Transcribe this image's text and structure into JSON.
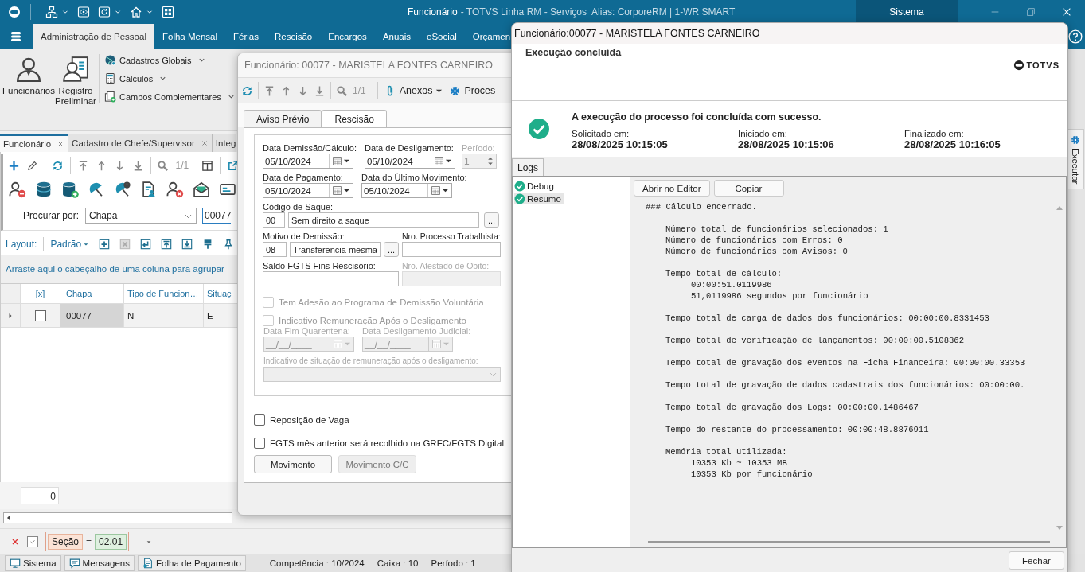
{
  "app": {
    "title_main": "Funcionário",
    "title_rest": "- TOTVS Linha RM - Serviços  Alias: CorporeRM | 1-WR SMART",
    "system_tab": "Sistema",
    "menu": [
      {
        "label": "Administração de Pessoal",
        "selected": true
      },
      {
        "label": "Folha Mensal",
        "selected": false
      },
      {
        "label": "Férias",
        "selected": false
      },
      {
        "label": "Rescisão",
        "selected": false
      },
      {
        "label": "Encargos",
        "selected": false
      },
      {
        "label": "Anuais",
        "selected": false
      },
      {
        "label": "eSocial",
        "selected": false
      },
      {
        "label": "Orçamen",
        "selected": false
      }
    ],
    "ribbon_big": [
      {
        "label": "Funcionários",
        "kind": "person"
      },
      {
        "label": "Registro Preliminar",
        "kind": "record"
      }
    ],
    "ribbon_small": [
      {
        "label": "Cadastros Globais",
        "kind": "globe"
      },
      {
        "label": "Cálculos",
        "kind": "calculator"
      },
      {
        "label": "Campos Complementares",
        "kind": "fields"
      }
    ],
    "doc_tabs": [
      {
        "label": "Funcionário",
        "selected": true,
        "closable": true
      },
      {
        "label": "Cadastro de Chefe/Supervisor",
        "selected": false,
        "closable": true
      },
      {
        "label": "Integ",
        "selected": false,
        "closable": false
      }
    ],
    "record_counter": "1/1",
    "search": {
      "label": "Procurar por:",
      "field": "Chapa",
      "value": "00077"
    },
    "layout": {
      "label": "Layout:",
      "value": "Padrão"
    },
    "group_hint": "Arraste aqui o cabeçalho de uma coluna para agrupar",
    "columns": [
      "[x]",
      "Chapa",
      "Tipo de Funcion…",
      "Situaç"
    ],
    "rows": [
      {
        "checked": false,
        "selected": true,
        "cells": [
          "",
          "00077",
          "N",
          "E"
        ]
      }
    ],
    "count": "0",
    "filter": {
      "enabled": true,
      "field": "Seção",
      "op": "=",
      "value": "02.01"
    },
    "status_items": [
      {
        "label": "Sistema",
        "kind": "monitor"
      },
      {
        "label": "Mensagens",
        "kind": "chat"
      },
      {
        "label": "Folha de Pagamento",
        "kind": "document"
      }
    ],
    "status_info": [
      "Competência : 10/2024",
      "Caixa : 10",
      "Período : 1"
    ],
    "side_tab": "Executar"
  },
  "rescisao": {
    "title": "Funcionário: 00077 - MARISTELA FONTES CARNEIRO",
    "counter": "1/1",
    "attach": "Anexos",
    "process": "Proces",
    "tabs": [
      {
        "label": "Aviso Prévio",
        "selected": false
      },
      {
        "label": "Rescisão",
        "selected": true
      }
    ],
    "dates": [
      {
        "label": "Data Demissão/Cálculo:",
        "value": "05/10/2024"
      },
      {
        "label": "Data de Desligamento:",
        "value": "05/10/2024"
      },
      {
        "label": "Data de Pagamento:",
        "value": "05/10/2024"
      },
      {
        "label": "Data do Último Movimento:",
        "value": "05/10/2024"
      }
    ],
    "period": {
      "label": "Período:",
      "value": "1",
      "disabled": true
    },
    "saque": {
      "label": "Código de Saque:",
      "code": "00",
      "description": "Sem direito a saque",
      "browse": "..."
    },
    "motivo": {
      "label": "Motivo de Demissão:",
      "code": "08",
      "description": "Transferencia mesma",
      "browse": "..."
    },
    "processo": {
      "label": "Nro. Processo Trabalhista:",
      "disabled": false
    },
    "saldo": {
      "label": "Saldo FGTS Fins Rescisório:",
      "disabled": false
    },
    "atestado": {
      "label": "Nro. Atestado de Obito:",
      "disabled": true
    },
    "pdv": {
      "label": "Tem Adesão ao Programa de Demissão Voluntária",
      "checked": false,
      "disabled": true
    },
    "remuneracao": {
      "label": "Indicativo Remuneração Após o Desligamento",
      "checked": false,
      "disabled": true,
      "quarentena_label": "Data Fim Quarentena:",
      "quarentena_value": "__/__/____",
      "judicial_label": "Data Desligamento Judicial:",
      "judicial_value": "__/__/____",
      "situacao_label": "Indicativo de situação de remuneração após o desligamento:"
    },
    "checks": [
      {
        "label": "Reposição de Vaga",
        "checked": false
      },
      {
        "label": "FGTS mês anterior será recolhido na GRFC/FGTS Digital",
        "checked": false
      }
    ],
    "buttons": [
      {
        "label": "Movimento",
        "disabled": false
      },
      {
        "label": "Movimento C/C",
        "disabled": true
      }
    ]
  },
  "execucao": {
    "title": "Funcionário:00077 - MARISTELA FONTES CARNEIRO",
    "heading": "Execução concluída",
    "logo": "TOTVS",
    "message": "A execução do processo foi concluída com sucesso.",
    "times": [
      {
        "label": "Solicitado em:",
        "value": "28/08/2025 10:15:05"
      },
      {
        "label": "Iniciado em:",
        "value": "28/08/2025 10:15:06"
      },
      {
        "label": "Finalizado em:",
        "value": "28/08/2025 10:16:05"
      }
    ],
    "logs_tab": "Logs",
    "tree": [
      {
        "label": "Debug",
        "selected": false
      },
      {
        "label": "Resumo",
        "selected": true
      }
    ],
    "actions": [
      "Abrir no Editor",
      "Copiar"
    ],
    "log_heading": "### Cálculo encerrado.",
    "log_groups": [
      [
        {
          "text": "Número total de funcionários selecionados: 1"
        },
        {
          "text": "Número de funcionários com Erros: 0"
        },
        {
          "text": "Número de funcionários com Avisos: 0"
        }
      ],
      [
        {
          "text": "Tempo total de cálculo:",
          "children": [
            "00:00:51.0119986",
            "51,0119986 segundos por funcionário"
          ]
        }
      ],
      [
        {
          "text": "Tempo total de carga de dados dos funcionários: 00:00:00.8331453"
        }
      ],
      [
        {
          "text": "Tempo total de verificação de lançamentos: 00:00:00.5108362"
        }
      ],
      [
        {
          "text": "Tempo total de gravação dos eventos na Ficha Financeira: 00:00:00.33353"
        }
      ],
      [
        {
          "text": "Tempo total de gravação de dados cadastrais dos funcionários: 00:00:00."
        }
      ],
      [
        {
          "text": "Tempo total de gravação dos Logs: 00:00:00.1486467"
        }
      ],
      [
        {
          "text": "Tempo do restante do processamento: 00:00:48.8876911"
        }
      ],
      [
        {
          "text": "Memória total utilizada:",
          "children": [
            "10353 Kb ~ 10353 MB",
            "10353 Kb por funcionário"
          ]
        }
      ]
    ],
    "close": "Fechar"
  }
}
